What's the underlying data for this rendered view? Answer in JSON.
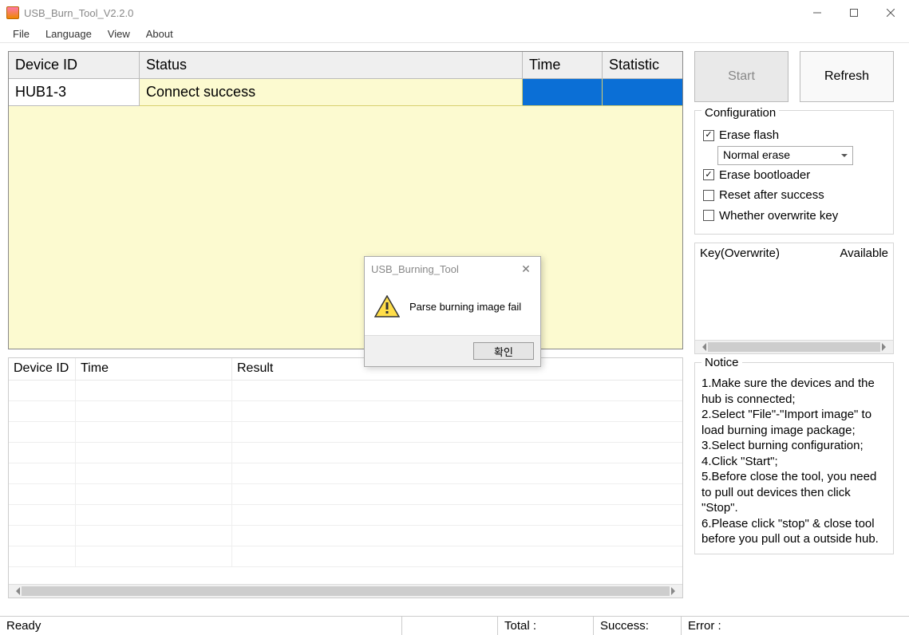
{
  "window": {
    "title": "USB_Burn_Tool_V2.2.0"
  },
  "menu": {
    "file": "File",
    "language": "Language",
    "view": "View",
    "about": "About"
  },
  "toptable": {
    "headers": {
      "device_id": "Device ID",
      "status": "Status",
      "time": "Time",
      "statistic": "Statistic"
    },
    "rows": [
      {
        "device_id": "HUB1-3",
        "status": "Connect success",
        "time": "",
        "statistic": ""
      }
    ]
  },
  "bottomtable": {
    "headers": {
      "device_id": "Device ID",
      "time": "Time",
      "result": "Result"
    }
  },
  "buttons": {
    "start": "Start",
    "refresh": "Refresh"
  },
  "configuration": {
    "legend": "Configuration",
    "erase_flash": {
      "checked": true,
      "label": "Erase flash"
    },
    "erase_mode": "Normal erase",
    "erase_bootloader": {
      "checked": true,
      "label": "Erase bootloader"
    },
    "reset_after_success": {
      "checked": false,
      "label": "Reset after success"
    },
    "overwrite_key": {
      "checked": false,
      "label": "Whether overwrite key"
    }
  },
  "keybox": {
    "left_label": "Key(Overwrite)",
    "right_label": "Available"
  },
  "notice": {
    "legend": "Notice",
    "lines": [
      "1.Make sure the devices and the hub is connected;",
      "2.Select \"File\"-\"Import image\" to load burning image package;",
      "3.Select burning configuration;",
      "4.Click \"Start\";",
      "5.Before close the tool, you need to pull out devices then click \"Stop\".",
      "6.Please click \"stop\" & close tool before you pull out a outside hub."
    ]
  },
  "statusbar": {
    "ready": "Ready",
    "total": "Total :",
    "success": "Success:",
    "error": "Error :"
  },
  "dialog": {
    "title": "USB_Burning_Tool",
    "message": "Parse burning image fail",
    "ok": "확인"
  }
}
